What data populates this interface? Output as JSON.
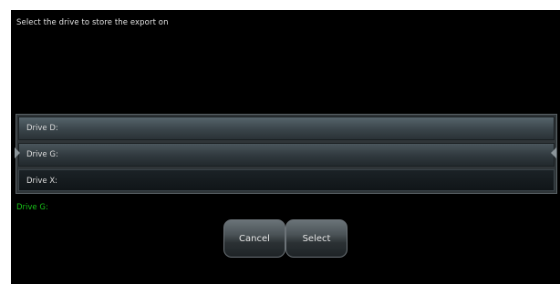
{
  "dialog": {
    "prompt": "Select the drive to store the export on",
    "drives": [
      {
        "label": "Drive D:"
      },
      {
        "label": "Drive G:"
      },
      {
        "label": "Drive X:"
      }
    ],
    "selected_status": "Drive G:",
    "buttons": {
      "cancel_label": "Cancel",
      "select_label": "Select"
    }
  },
  "colors": {
    "background": "#000000",
    "text": "#e2e2e2",
    "status_green": "#19c419"
  },
  "icons": {
    "selection_markers": "triangle-arrow-icon"
  }
}
